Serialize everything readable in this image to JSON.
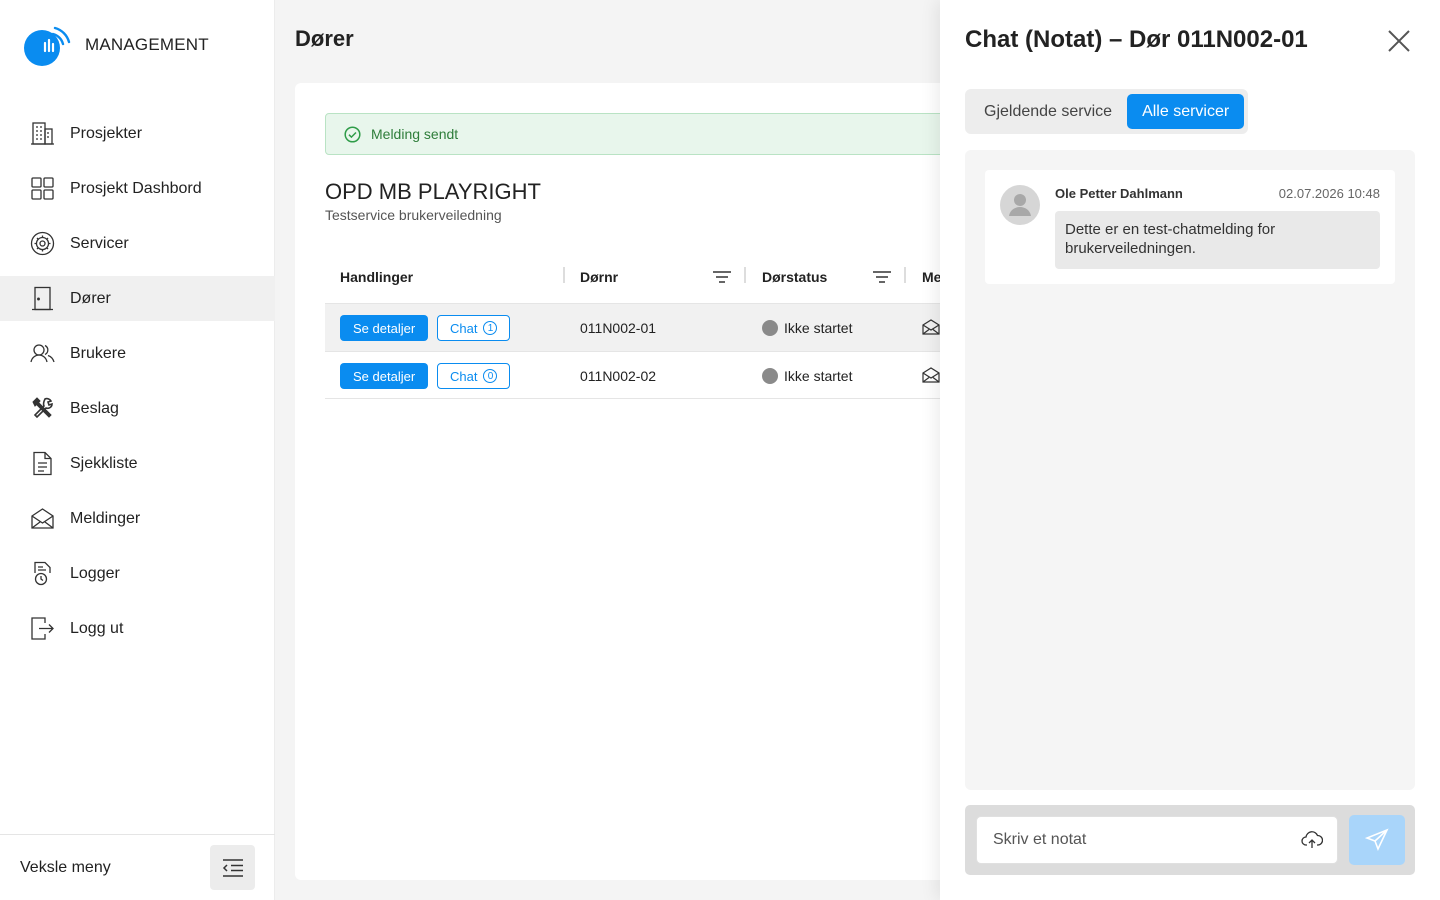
{
  "brand": {
    "name": "MANAGEMENT",
    "accent": "#0a8cf0"
  },
  "sidebar": {
    "items": [
      {
        "label": "Prosjekter",
        "icon": "building-icon"
      },
      {
        "label": "Prosjekt Dashbord",
        "icon": "dashboard-icon"
      },
      {
        "label": "Servicer",
        "icon": "service-gear-icon"
      },
      {
        "label": "Dører",
        "icon": "door-icon",
        "active": true
      },
      {
        "label": "Brukere",
        "icon": "users-icon"
      },
      {
        "label": "Beslag",
        "icon": "tools-icon"
      },
      {
        "label": "Sjekkliste",
        "icon": "checklist-icon"
      },
      {
        "label": "Meldinger",
        "icon": "envelope-icon"
      },
      {
        "label": "Logger",
        "icon": "log-icon"
      },
      {
        "label": "Logg ut",
        "icon": "logout-icon"
      }
    ],
    "toggle_label": "Veksle meny"
  },
  "main": {
    "title": "Dører",
    "alert": "Melding sendt",
    "project_title": "OPD MB PLAYRIGHT",
    "project_subtitle": "Testservice brukerveiledning",
    "table": {
      "headers": {
        "actions": "Handlinger",
        "door": "Dørnr",
        "status": "Dørstatus",
        "messages": "Me"
      },
      "rows": [
        {
          "details_label": "Se detaljer",
          "chat_label": "Chat",
          "chat_count": "1",
          "door": "011N002-01",
          "status": "Ikke startet"
        },
        {
          "details_label": "Se detaljer",
          "chat_label": "Chat",
          "chat_count": "0",
          "door": "011N002-02",
          "status": "Ikke startet"
        }
      ]
    }
  },
  "drawer": {
    "title": "Chat (Notat) – Dør 011N002-01",
    "tabs": {
      "current": "Gjeldende service",
      "all": "Alle servicer"
    },
    "messages": [
      {
        "author": "Ole Petter Dahlmann",
        "time": "02.07.2026 10:48",
        "text": "Dette er en test-chatmelding for brukerveiledningen."
      }
    ],
    "input_placeholder": "Skriv et notat"
  }
}
